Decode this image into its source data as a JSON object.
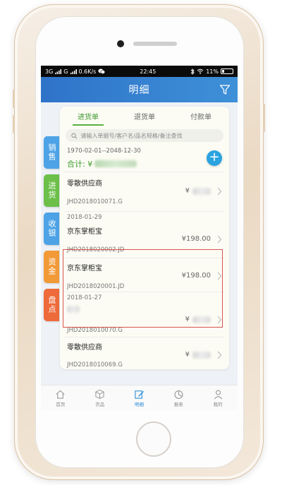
{
  "status_bar": {
    "carrier": "3G",
    "carrier2": "G",
    "speed": "0.6K/s",
    "time": "22:45",
    "battery": "11%"
  },
  "nav": {
    "title": "明细",
    "filter_icon": "filter-icon"
  },
  "side_tabs": [
    {
      "label": "销售",
      "color": "#4da3e6"
    },
    {
      "label": "进货",
      "color": "#6cc04a"
    },
    {
      "label": "收银",
      "color": "#4da3e6"
    },
    {
      "label": "资金",
      "color": "#f29a38"
    },
    {
      "label": "盘点",
      "color": "#ee6a3a"
    }
  ],
  "tabs": [
    {
      "label": "进货单",
      "active": true
    },
    {
      "label": "退货单",
      "active": false
    },
    {
      "label": "付款单",
      "active": false
    }
  ],
  "search": {
    "placeholder": "请输入单据号/客户名/品名规格/备注查找",
    "value": ""
  },
  "summary": {
    "date_range": "1970-02-01--2048-12-30",
    "total_label": "合计: ¥",
    "total_value": ""
  },
  "records": [
    {
      "group_date": "",
      "name": "零散供应商",
      "amount_prefix": "¥",
      "amount": "",
      "code": "JHD2018010071.G"
    },
    {
      "group_date": "2018-01-29",
      "name": "京东掌柜宝",
      "amount_prefix": "",
      "amount": "¥198.00",
      "code": "JHD2018020002.JD"
    },
    {
      "group_date": "",
      "name": "京东掌柜宝",
      "amount_prefix": "",
      "amount": "¥198.00",
      "code": "JHD2018020001.JD"
    },
    {
      "group_date": "2018-01-27",
      "name": "",
      "amount_prefix": "¥",
      "amount": "",
      "code": "JHD2018010070.G"
    },
    {
      "group_date": "",
      "name": "零散供应商",
      "amount_prefix": "¥",
      "amount": "",
      "code": "JHD2018010069.G"
    }
  ],
  "tabbar": [
    {
      "label": "首页",
      "icon": "home-icon",
      "active": false
    },
    {
      "label": "货品",
      "icon": "box-icon",
      "active": false
    },
    {
      "label": "明细",
      "icon": "edit-icon",
      "active": true
    },
    {
      "label": "报表",
      "icon": "pie-chart-icon",
      "active": false
    },
    {
      "label": "我的",
      "icon": "user-icon",
      "active": false
    }
  ],
  "colors": {
    "nav": "#2f73c9",
    "accent_green": "#3e9a2e",
    "highlight": "#d9534f",
    "active_tab": "#2f8fd8"
  }
}
